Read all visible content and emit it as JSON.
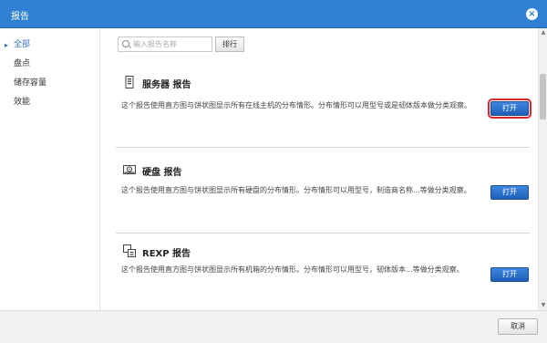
{
  "window": {
    "title": "报告",
    "close_icon": "×"
  },
  "sidebar": {
    "items": [
      {
        "label": "全部",
        "active": true
      },
      {
        "label": "盘点",
        "active": false
      },
      {
        "label": "储存容量",
        "active": false
      },
      {
        "label": "效能",
        "active": false
      }
    ]
  },
  "search": {
    "placeholder": "输入报告名称",
    "sort_label": "排行"
  },
  "reports": [
    {
      "title": "服务器 报告",
      "icon": "server-icon",
      "description": "这个报告使用直方图与饼状图显示所有在线主机的分布情形。分布情形可以用型号或是韧体版本做分类观察。",
      "button": "打开",
      "focused": true
    },
    {
      "title": "硬盘 报告",
      "icon": "disk-icon",
      "description": "这个报告使用直方图与饼状图显示所有硬盘的分布情形。分布情形可以用型号，制造商名称...等做分类观察。",
      "button": "打开",
      "focused": false
    },
    {
      "title": "REXP 报告",
      "icon": "enclosure-icon",
      "description": "这个报告使用直方图与饼状图显示所有机箱的分布情形。分布情形可以用型号，韧体版本...等做分类观察。",
      "button": "打开",
      "focused": false
    }
  ],
  "footer": {
    "cancel_label": "取消"
  },
  "colors": {
    "titlebar": "#2f7fd2",
    "accent": "#1f5fb8",
    "focus": "#d9262c"
  }
}
